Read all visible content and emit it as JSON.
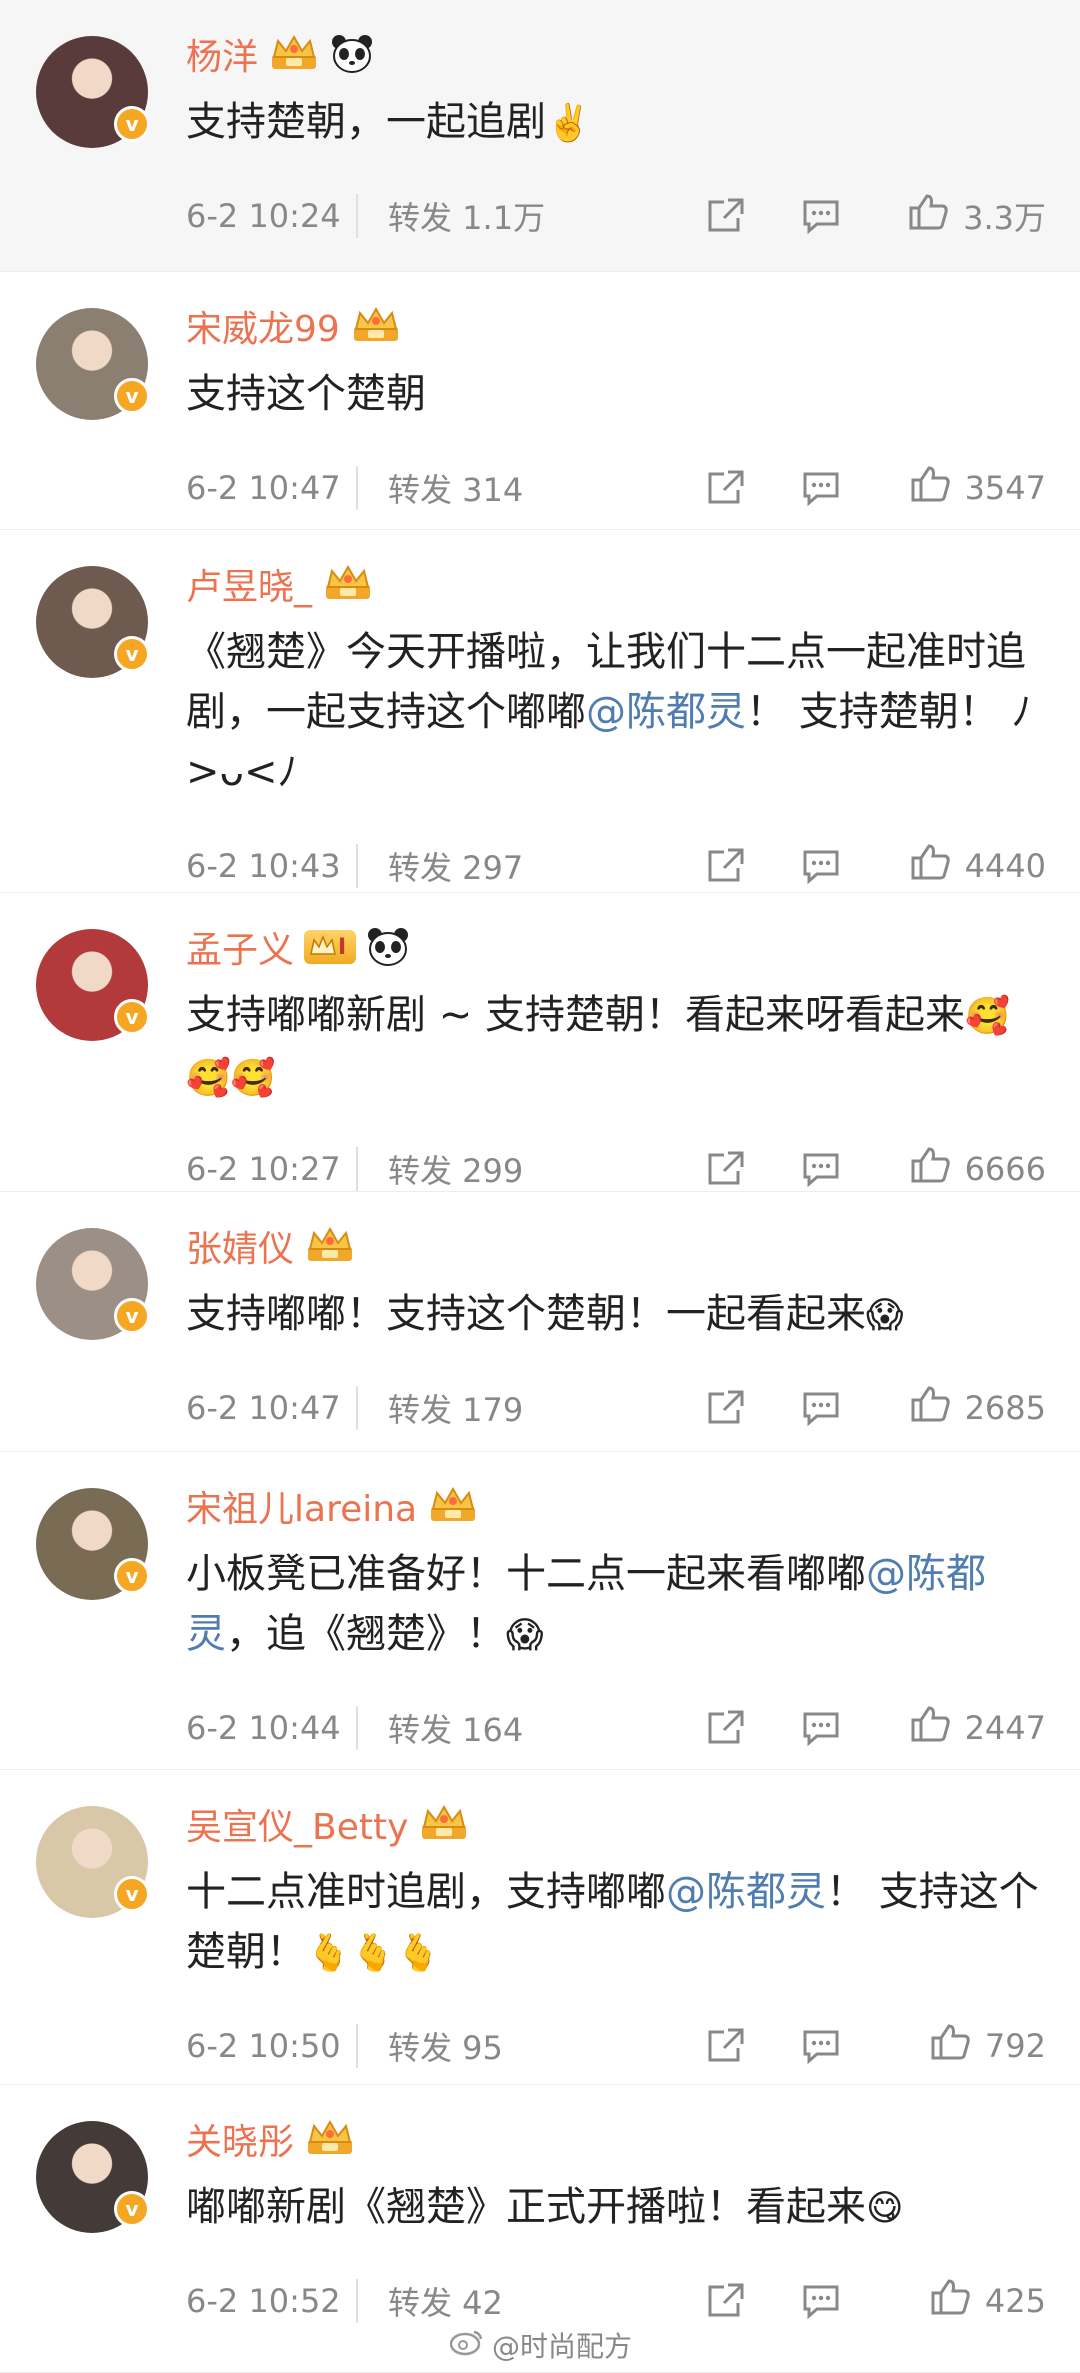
{
  "posts": [
    {
      "name": "杨洋",
      "badges": [
        "crown",
        "panda"
      ],
      "content": [
        {
          "t": "支持楚朝，一起追剧"
        },
        {
          "e": "✌️"
        }
      ],
      "time": "6-2 10:24",
      "repost": "转发 1.1万",
      "likes": "3.3万"
    },
    {
      "name": "宋威龙99",
      "badges": [
        "crown"
      ],
      "content": [
        {
          "t": "支持这个楚朝"
        }
      ],
      "time": "6-2 10:47",
      "repost": "转发 314",
      "likes": "3547"
    },
    {
      "name": "卢昱晓_",
      "badges": [
        "crown"
      ],
      "content": [
        {
          "t": "《翘楚》今天开播啦，让我们十二点一起准时追剧，一起支持这个嘟嘟"
        },
        {
          "m": "@陈都灵"
        },
        {
          "t": "！ 支持楚朝！ "
        },
        {
          "t": "ﾉ>ᴗ<ﾉ"
        }
      ],
      "time": "6-2 10:43",
      "repost": "转发 297",
      "likes": "4440"
    },
    {
      "name": "孟子义",
      "badges": [
        "member",
        "panda"
      ],
      "member_level": "I",
      "content": [
        {
          "t": "支持嘟嘟新剧 ~ 支持楚朝！看起来呀看起来"
        },
        {
          "e": "🥰🥰🥰"
        }
      ],
      "time": "6-2 10:27",
      "repost": "转发 299",
      "likes": "6666"
    },
    {
      "name": "张婧仪",
      "badges": [
        "crown"
      ],
      "content": [
        {
          "t": "支持嘟嘟！支持这个楚朝！一起看起来"
        },
        {
          "e": "😱"
        }
      ],
      "time": "6-2 10:47",
      "repost": "转发 179",
      "likes": "2685"
    },
    {
      "name": "宋祖儿lareina",
      "badges": [
        "crown"
      ],
      "content": [
        {
          "t": "小板凳已准备好！十二点一起来看嘟嘟"
        },
        {
          "m": "@陈都灵"
        },
        {
          "t": "，追《翘楚》！"
        },
        {
          "e": "😱"
        }
      ],
      "time": "6-2 10:44",
      "repost": "转发 164",
      "likes": "2447"
    },
    {
      "name": "吴宣仪_Betty",
      "badges": [
        "crown"
      ],
      "content": [
        {
          "t": "十二点准时追剧，支持嘟嘟"
        },
        {
          "m": "@陈都灵"
        },
        {
          "t": "！ 支持这个楚朝！"
        },
        {
          "e": "🫰🫰🫰"
        }
      ],
      "time": "6-2 10:50",
      "repost": "转发 95",
      "likes": "792"
    },
    {
      "name": "关晓彤",
      "badges": [
        "crown"
      ],
      "content": [
        {
          "t": "嘟嘟新剧《翘楚》正式开播啦！看起来"
        },
        {
          "e": "😋"
        }
      ],
      "time": "6-2 10:52",
      "repost": "转发 42",
      "likes": "425"
    }
  ],
  "avatar_badge": "v",
  "watermark": "@时尚配方",
  "colors": {
    "name": "#eb7350",
    "mention": "#507daf",
    "meta": "#888888",
    "badge": "#f5a623"
  }
}
